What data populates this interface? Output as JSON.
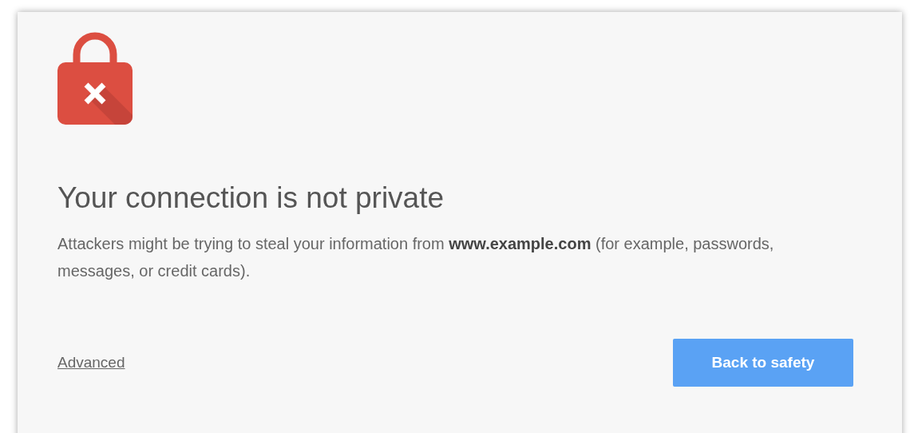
{
  "heading": "Your connection is not private",
  "message": "Attackers might be trying to steal your information from **www.example.com** (for example, passwords, messages, or credit cards).",
  "advanced_link": "Advanced",
  "buttons": [
    "Back to safety"
  ]
}
